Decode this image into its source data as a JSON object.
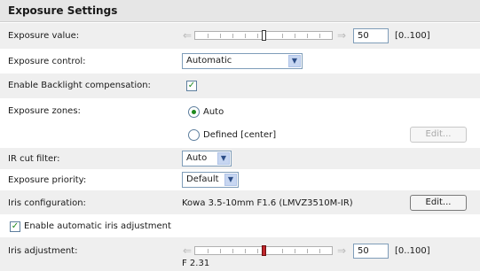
{
  "title": "Exposure Settings",
  "exposure_value": {
    "label": "Exposure value:",
    "value": "50",
    "range": "[0..100]",
    "slider_fraction": 0.5
  },
  "exposure_control": {
    "label": "Exposure control:",
    "selected": "Automatic"
  },
  "backlight": {
    "label": "Enable Backlight compensation:",
    "checked": true
  },
  "exposure_zones": {
    "label": "Exposure zones:",
    "option_auto": "Auto",
    "option_defined": "Defined [center]",
    "selected": "Auto",
    "edit_label": "Edit..."
  },
  "ir_cut_filter": {
    "label": "IR cut filter:",
    "selected": "Auto"
  },
  "exposure_priority": {
    "label": "Exposure priority:",
    "selected": "Default"
  },
  "iris_configuration": {
    "label": "Iris configuration:",
    "value": "Kowa 3.5-10mm F1.6 (LMVZ3510M-IR)",
    "edit_label": "Edit..."
  },
  "auto_iris": {
    "label": "Enable automatic iris adjustment",
    "checked": true
  },
  "iris_adjustment": {
    "label": "Iris adjustment:",
    "value": "50",
    "range": "[0..100]",
    "f_number": "F 2.31",
    "slider_fraction": 0.5
  },
  "colors": {
    "header_bg": "#e6e6e6",
    "row_shade": "#efefef",
    "check_green": "#1e8a1e",
    "iris_thumb": "#c0272d"
  }
}
